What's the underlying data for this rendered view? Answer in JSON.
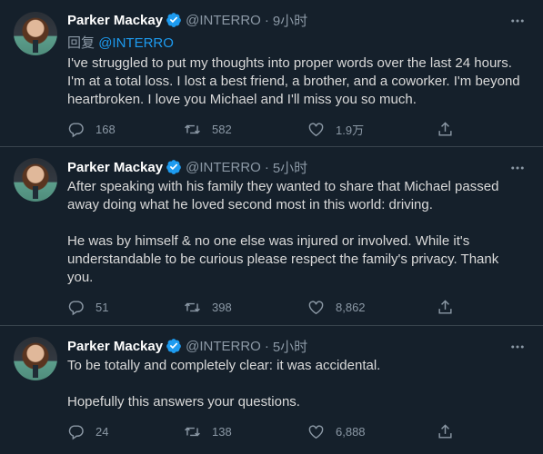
{
  "tweets": [
    {
      "author": "Parker Mackay",
      "handle": "@INTERRO",
      "separator": "·",
      "time": "9小时",
      "reply_prefix": "回复",
      "reply_to": "@INTERRO",
      "text": "I've struggled to put my thoughts into proper words over the last 24 hours. I'm at a total loss. I lost a best friend, a brother, and a coworker. I'm beyond heartbroken. I love you Michael and I'll miss you so much.",
      "replies": "168",
      "retweets": "582",
      "likes": "1.9万"
    },
    {
      "author": "Parker Mackay",
      "handle": "@INTERRO",
      "separator": "·",
      "time": "5小时",
      "text": "After speaking with his family they wanted to share that Michael passed away doing what he loved second most in this world: driving.\n\nHe was by himself & no one else was injured or involved. While it's understandable to be curious please respect the family's privacy. Thank you.",
      "replies": "51",
      "retweets": "398",
      "likes": "8,862"
    },
    {
      "author": "Parker Mackay",
      "handle": "@INTERRO",
      "separator": "·",
      "time": "5小时",
      "text": "To be totally and completely clear: it was accidental.\n\nHopefully this answers your questions.",
      "replies": "24",
      "retweets": "138",
      "likes": "6,888"
    }
  ],
  "icons": {
    "verified": "verified-badge-icon",
    "more": "more-icon",
    "reply": "reply-icon",
    "retweet": "retweet-icon",
    "like": "heart-icon",
    "share": "share-icon"
  },
  "colors": {
    "background": "#15202b",
    "accent": "#1d9bf0",
    "muted": "#8b98a5",
    "divider": "#38444d"
  }
}
